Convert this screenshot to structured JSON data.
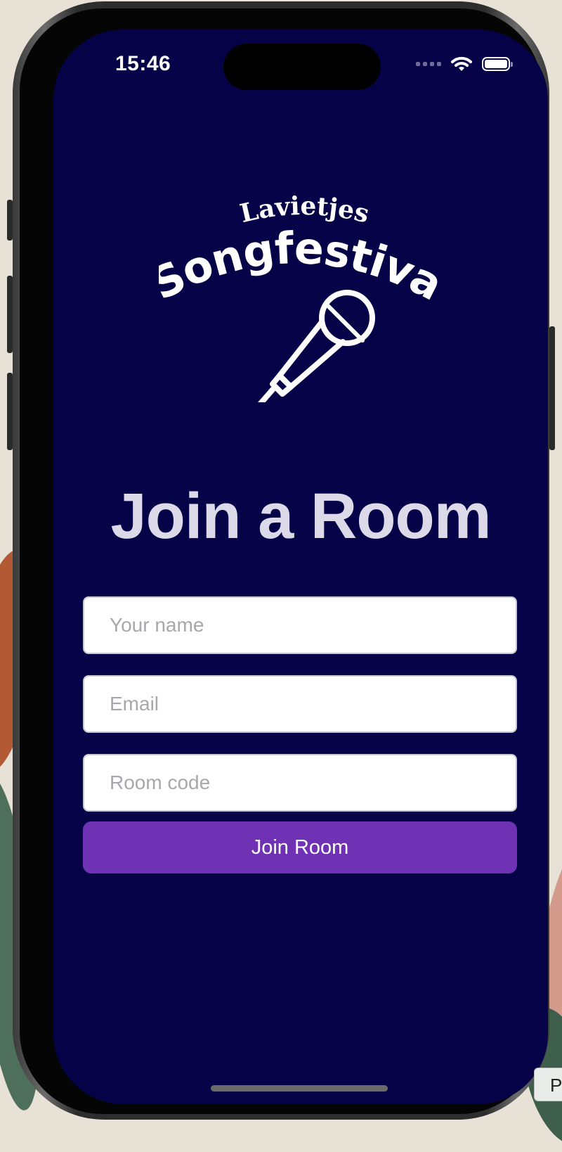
{
  "status_bar": {
    "time": "15:46",
    "icons": [
      "signal-dots-icon",
      "wifi-icon",
      "battery-icon"
    ],
    "battery_level": 1.0
  },
  "logo": {
    "top_text": "Lavietjes",
    "main_text": "Songfestival",
    "icon": "microphone-icon"
  },
  "page": {
    "title": "Join a Room"
  },
  "form": {
    "name": {
      "placeholder": "Your name",
      "value": ""
    },
    "email": {
      "placeholder": "Email",
      "value": ""
    },
    "room_code": {
      "placeholder": "Room code",
      "value": ""
    },
    "submit_label": "Join Room"
  },
  "desktop": {
    "corner_button_label": "P"
  },
  "colors": {
    "background": "#060248",
    "title": "#dcd9e8",
    "button": "#6f32b4",
    "field_background": "#ffffff",
    "placeholder": "#a7a7ad"
  }
}
